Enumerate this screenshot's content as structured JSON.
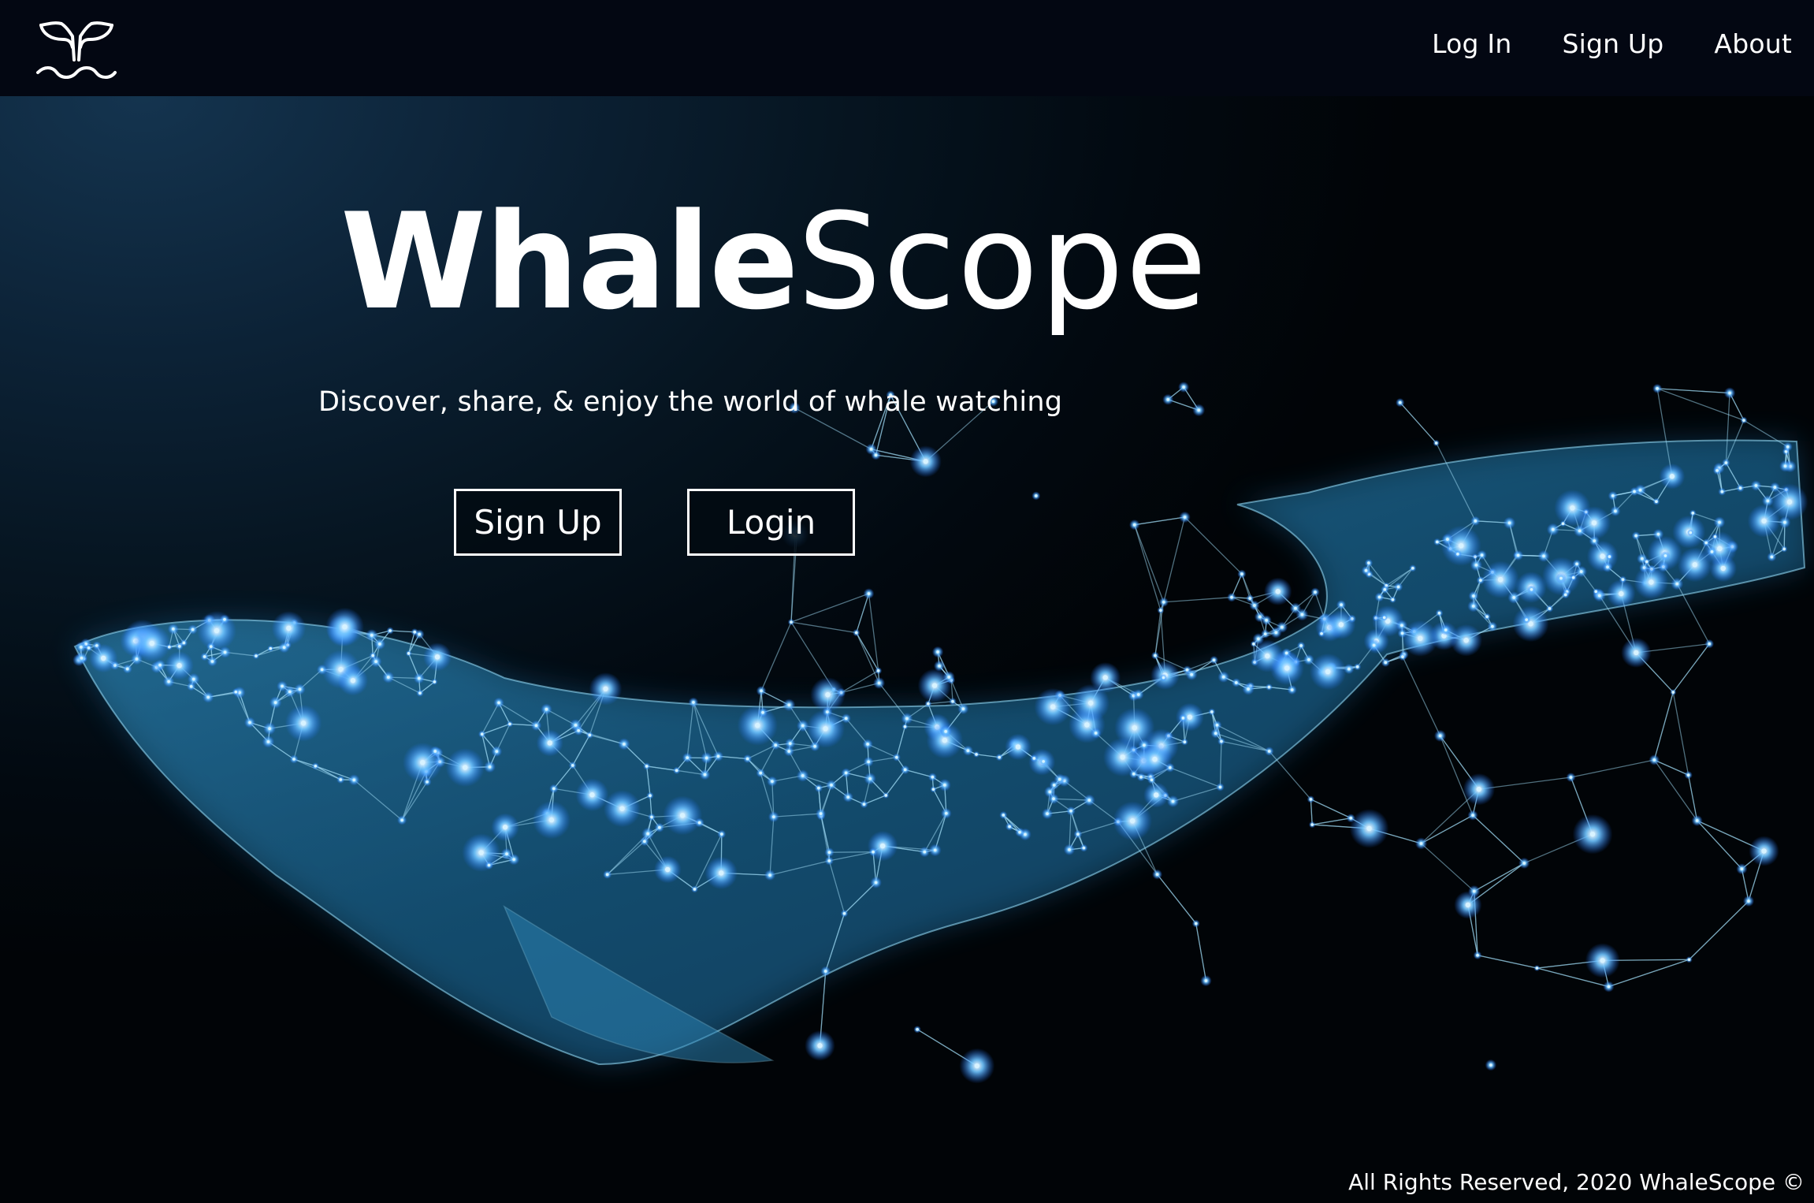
{
  "nav": {
    "logo_icon": "whale-tail-icon",
    "links": [
      "Log In",
      "Sign Up",
      "About"
    ]
  },
  "hero": {
    "title_bold": "Whale",
    "title_light": "Scope",
    "tagline": "Discover, share, & enjoy the world of whale watching",
    "signup_label": "Sign Up",
    "login_label": "Login"
  },
  "footer": {
    "copyright": "All Rights Reserved, 2020 WhaleScope ©"
  },
  "colors": {
    "background": "#061521",
    "navbar": "#030712",
    "text": "#ffffff",
    "glow": "#4aa8ff"
  }
}
